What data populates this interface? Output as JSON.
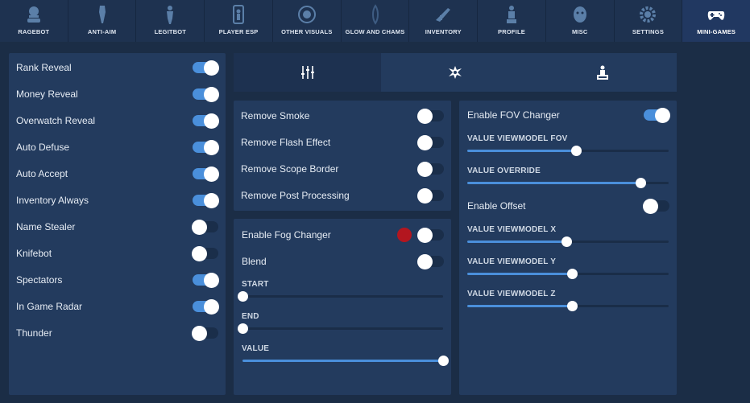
{
  "nav": {
    "items": [
      {
        "label": "RAGEBOT",
        "icon": "ragebot-icon"
      },
      {
        "label": "ANTI-AIM",
        "icon": "anti-aim-icon"
      },
      {
        "label": "LEGITBOT",
        "icon": "legitbot-icon"
      },
      {
        "label": "PLAYER ESP",
        "icon": "player-esp-icon"
      },
      {
        "label": "OTHER VISUALS",
        "icon": "other-visuals-icon"
      },
      {
        "label": "GLOW AND CHAMS",
        "icon": "glow-and-chams-icon"
      },
      {
        "label": "INVENTORY",
        "icon": "inventory-icon"
      },
      {
        "label": "PROFILE",
        "icon": "profile-icon"
      },
      {
        "label": "MISC",
        "icon": "misc-icon"
      },
      {
        "label": "SETTINGS",
        "icon": "settings-gear-icon"
      },
      {
        "label": "MINI-GAMES",
        "icon": "gamepad-icon"
      }
    ],
    "active": "MINI-GAMES"
  },
  "left_panel": {
    "toggles": [
      {
        "label": "Rank Reveal",
        "on": true
      },
      {
        "label": "Money Reveal",
        "on": true
      },
      {
        "label": "Overwatch Reveal",
        "on": true
      },
      {
        "label": "Auto Defuse",
        "on": true
      },
      {
        "label": "Auto Accept",
        "on": true
      },
      {
        "label": "Inventory Always",
        "on": true
      },
      {
        "label": "Name Stealer",
        "on": false
      },
      {
        "label": "Knifebot",
        "on": false
      },
      {
        "label": "Spectators",
        "on": true
      },
      {
        "label": "In Game Radar",
        "on": true
      },
      {
        "label": "Thunder",
        "on": false
      }
    ]
  },
  "tabs": [
    {
      "icon": "sliders-icon",
      "active": true
    },
    {
      "icon": "crosshair-splat-icon",
      "active": false
    },
    {
      "icon": "podium-icon",
      "active": false
    }
  ],
  "removals_panel": {
    "toggles": [
      {
        "label": "Remove Smoke",
        "on": false
      },
      {
        "label": "Remove Flash Effect",
        "on": false
      },
      {
        "label": "Remove Scope Border",
        "on": false
      },
      {
        "label": "Remove Post Processing",
        "on": false
      }
    ]
  },
  "fog_panel": {
    "fog_toggle": {
      "label": "Enable Fog Changer",
      "on": false,
      "color": "#b3161f"
    },
    "blend_toggle": {
      "label": "Blend",
      "on": false
    },
    "sliders": [
      {
        "label": "START",
        "value": 0.0
      },
      {
        "label": "END",
        "value": 0.0
      },
      {
        "label": "VALUE",
        "value": 1.0
      }
    ]
  },
  "fov_panel": {
    "fov_toggle": {
      "label": "Enable FOV Changer",
      "on": true
    },
    "fov_sliders": [
      {
        "label": "VALUE VIEWMODEL FOV",
        "value": 0.54
      },
      {
        "label": "VALUE OVERRIDE",
        "value": 0.86
      }
    ],
    "offset_toggle": {
      "label": "Enable Offset",
      "on": false
    },
    "offset_sliders": [
      {
        "label": "VALUE VIEWMODEL X",
        "value": 0.49
      },
      {
        "label": "VALUE VIEWMODEL Y",
        "value": 0.52
      },
      {
        "label": "VALUE VIEWMODEL Z",
        "value": 0.52
      }
    ]
  },
  "colors": {
    "accent": "#4a8fdb",
    "panel": "#233b5e",
    "background": "#1b2d46"
  }
}
